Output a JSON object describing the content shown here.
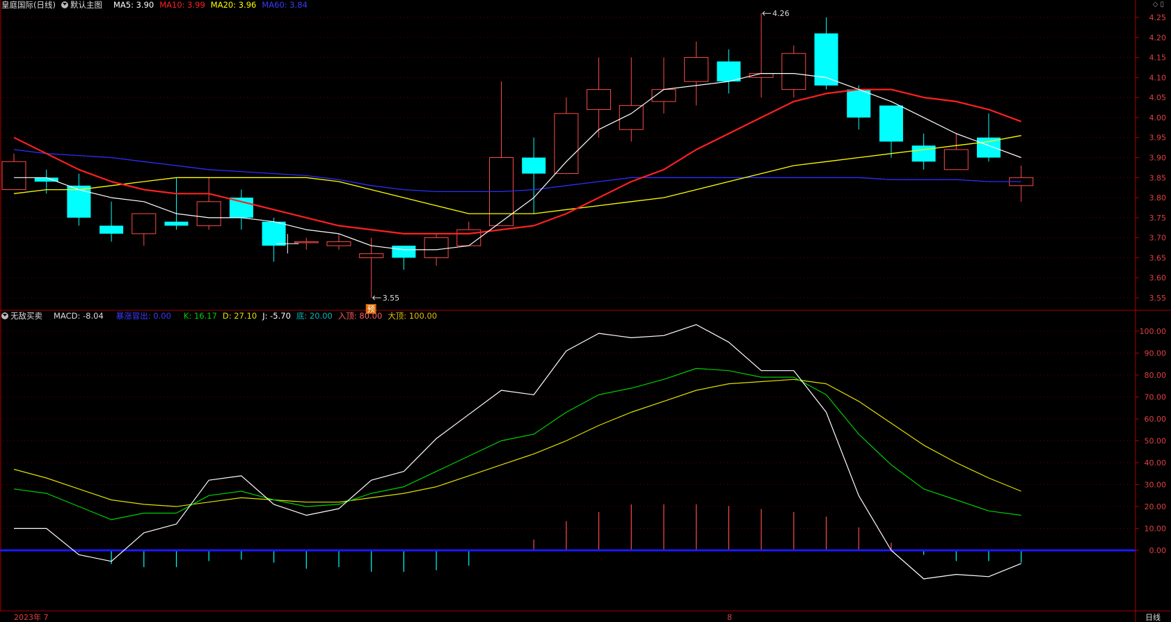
{
  "main_header": {
    "title": "皇庭国际(日线)",
    "template": "默认主图",
    "ma5": "MA5: 3.90",
    "ma10": "MA10: 3.99",
    "ma20": "MA20: 3.96",
    "ma60": "MA60: 3.84"
  },
  "sub_header": {
    "title": "无敌买卖",
    "macd": "MACD: -8.04",
    "breakout": "暴涨冒出: 0.00",
    "k": "K: 16.17",
    "d": "D: 27.10",
    "j": "J: -5.70",
    "bottom": "底: 20.00",
    "entry_top": "入顶: 80.00",
    "big_top": "大顶: 100.00"
  },
  "colors": {
    "up": "#ff4b4b",
    "down": "#00ffff",
    "ma5": "#ffffff",
    "ma10": "#ff2020",
    "ma20": "#ffff00",
    "ma60": "#2d2dff",
    "k": "#00d000",
    "d": "#e0e000",
    "j": "#ffffff",
    "axis": "#aa0000",
    "tick_text": "#e04040"
  },
  "annotations": {
    "high_label": "4.26",
    "low_label": "3.55",
    "marker": "预"
  },
  "footer": {
    "date_start": "2023年 7",
    "date_mid": "8",
    "period": "日线"
  },
  "chart_data": [
    {
      "type": "candlestick",
      "title": "皇庭国际(日线)",
      "ylim": [
        3.52,
        4.27
      ],
      "y_ticks": [
        "4.25",
        "4.20",
        "4.15",
        "4.10",
        "4.05",
        "4.00",
        "3.95",
        "3.90",
        "3.85",
        "3.80",
        "3.75",
        "3.70",
        "3.65",
        "3.60",
        "3.55"
      ],
      "candles": [
        {
          "o": 3.82,
          "h": 3.91,
          "l": 3.82,
          "c": 3.89
        },
        {
          "o": 3.85,
          "h": 3.87,
          "l": 3.81,
          "c": 3.84
        },
        {
          "o": 3.83,
          "h": 3.86,
          "l": 3.73,
          "c": 3.75
        },
        {
          "o": 3.73,
          "h": 3.79,
          "l": 3.69,
          "c": 3.71
        },
        {
          "o": 3.71,
          "h": 3.76,
          "l": 3.68,
          "c": 3.76
        },
        {
          "o": 3.74,
          "h": 3.85,
          "l": 3.72,
          "c": 3.73
        },
        {
          "o": 3.73,
          "h": 3.85,
          "l": 3.72,
          "c": 3.79
        },
        {
          "o": 3.8,
          "h": 3.82,
          "l": 3.72,
          "c": 3.75
        },
        {
          "o": 3.74,
          "h": 3.75,
          "l": 3.64,
          "c": 3.68
        },
        {
          "o": 3.69,
          "h": 3.7,
          "l": 3.67,
          "c": 3.69
        },
        {
          "o": 3.68,
          "h": 3.71,
          "l": 3.67,
          "c": 3.69
        },
        {
          "o": 3.65,
          "h": 3.7,
          "l": 3.55,
          "c": 3.66
        },
        {
          "o": 3.68,
          "h": 3.68,
          "l": 3.62,
          "c": 3.65
        },
        {
          "o": 3.65,
          "h": 3.71,
          "l": 3.63,
          "c": 3.7
        },
        {
          "o": 3.68,
          "h": 3.74,
          "l": 3.68,
          "c": 3.72
        },
        {
          "o": 3.73,
          "h": 4.09,
          "l": 3.73,
          "c": 3.9
        },
        {
          "o": 3.9,
          "h": 3.95,
          "l": 3.76,
          "c": 3.86
        },
        {
          "o": 3.86,
          "h": 4.05,
          "l": 3.86,
          "c": 4.01
        },
        {
          "o": 4.02,
          "h": 4.15,
          "l": 3.95,
          "c": 4.07
        },
        {
          "o": 3.97,
          "h": 4.15,
          "l": 3.94,
          "c": 4.03
        },
        {
          "o": 4.04,
          "h": 4.15,
          "l": 4.01,
          "c": 4.07
        },
        {
          "o": 4.09,
          "h": 4.19,
          "l": 4.03,
          "c": 4.15
        },
        {
          "o": 4.14,
          "h": 4.17,
          "l": 4.06,
          "c": 4.09
        },
        {
          "o": 4.1,
          "h": 4.26,
          "l": 4.05,
          "c": 4.11
        },
        {
          "o": 4.07,
          "h": 4.18,
          "l": 4.05,
          "c": 4.16
        },
        {
          "o": 4.21,
          "h": 4.25,
          "l": 4.07,
          "c": 4.08
        },
        {
          "o": 4.07,
          "h": 4.08,
          "l": 3.97,
          "c": 4.0
        },
        {
          "o": 4.03,
          "h": 4.03,
          "l": 3.9,
          "c": 3.94
        },
        {
          "o": 3.93,
          "h": 3.96,
          "l": 3.87,
          "c": 3.89
        },
        {
          "o": 3.87,
          "h": 3.96,
          "l": 3.87,
          "c": 3.92
        },
        {
          "o": 3.95,
          "h": 4.01,
          "l": 3.89,
          "c": 3.9
        },
        {
          "o": 3.83,
          "h": 3.88,
          "l": 3.79,
          "c": 3.85
        }
      ],
      "ma5": [
        3.85,
        3.85,
        3.82,
        3.8,
        3.79,
        3.76,
        3.75,
        3.75,
        3.74,
        3.72,
        3.71,
        3.68,
        3.67,
        3.67,
        3.68,
        3.74,
        3.8,
        3.89,
        3.97,
        4.01,
        4.07,
        4.08,
        4.09,
        4.11,
        4.11,
        4.1,
        4.07,
        4.04,
        4.0,
        3.96,
        3.93,
        3.9
      ],
      "ma10": [
        3.95,
        3.91,
        3.87,
        3.84,
        3.82,
        3.81,
        3.81,
        3.79,
        3.77,
        3.75,
        3.73,
        3.72,
        3.71,
        3.71,
        3.71,
        3.72,
        3.73,
        3.76,
        3.8,
        3.84,
        3.87,
        3.92,
        3.96,
        4.0,
        4.04,
        4.06,
        4.07,
        4.07,
        4.05,
        4.04,
        4.02,
        3.99
      ],
      "ma20": [
        3.81,
        3.82,
        3.82,
        3.83,
        3.84,
        3.85,
        3.85,
        3.85,
        3.85,
        3.85,
        3.84,
        3.82,
        3.8,
        3.78,
        3.76,
        3.76,
        3.76,
        3.77,
        3.78,
        3.79,
        3.8,
        3.82,
        3.84,
        3.86,
        3.88,
        3.89,
        3.9,
        3.91,
        3.92,
        3.93,
        3.94,
        3.955
      ],
      "ma60": [
        3.92,
        3.91,
        3.905,
        3.9,
        3.89,
        3.88,
        3.87,
        3.865,
        3.86,
        3.855,
        3.845,
        3.83,
        3.82,
        3.815,
        3.815,
        3.815,
        3.82,
        3.83,
        3.84,
        3.85,
        3.85,
        3.85,
        3.85,
        3.85,
        3.85,
        3.85,
        3.85,
        3.845,
        3.845,
        3.845,
        3.84,
        3.84
      ]
    },
    {
      "type": "line",
      "title": "无敌买卖",
      "ylim": [
        -28,
        104
      ],
      "y_ticks": [
        "100.00",
        "90.00",
        "80.00",
        "70.00",
        "60.00",
        "50.00",
        "40.00",
        "30.00",
        "20.00",
        "10.00",
        "0.00"
      ],
      "series": [
        {
          "name": "K",
          "values": [
            28,
            26,
            20,
            14,
            17,
            17,
            25,
            27,
            23,
            20,
            21,
            26,
            29,
            36,
            43,
            50,
            53,
            63,
            71,
            74,
            78,
            83,
            82,
            79,
            79,
            71,
            53,
            39,
            28,
            23,
            18,
            16
          ]
        },
        {
          "name": "D",
          "values": [
            37,
            33,
            28,
            23,
            21,
            20,
            22,
            24,
            23,
            22,
            22,
            24,
            26,
            29,
            34,
            39,
            44,
            50,
            57,
            63,
            68,
            73,
            76,
            77,
            78,
            76,
            68,
            58,
            48,
            40,
            33,
            27
          ]
        },
        {
          "name": "J",
          "values": [
            10,
            10,
            -2,
            -5,
            8,
            12,
            32,
            34,
            21,
            16,
            19,
            32,
            36,
            51,
            62,
            73,
            71,
            91,
            99,
            97,
            98,
            103,
            95,
            82,
            82,
            63,
            25,
            0,
            -13,
            -11,
            -12,
            -6
          ]
        },
        {
          "name": "MACD",
          "values": [
            0,
            0,
            -1,
            -9,
            -11,
            -11,
            -7,
            -6,
            -8,
            -12,
            -11,
            -14,
            -14,
            -13,
            -10,
            0,
            7,
            19,
            25,
            30,
            30,
            30,
            29,
            27,
            25,
            22,
            15,
            5,
            -3,
            -7,
            -7,
            -8
          ]
        }
      ]
    }
  ]
}
